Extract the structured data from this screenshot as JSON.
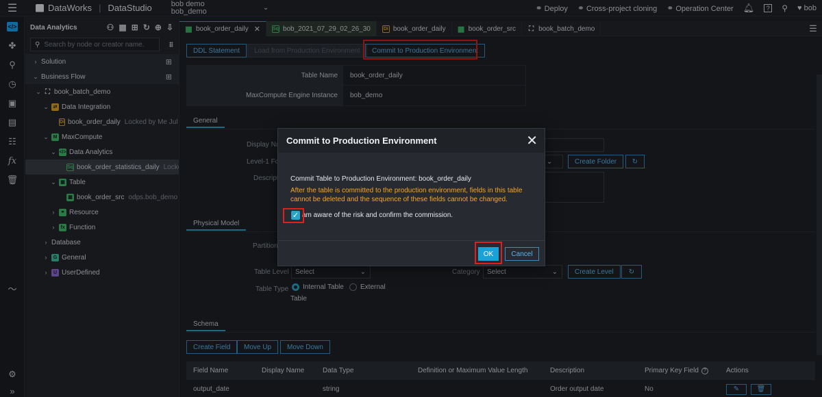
{
  "topbar": {
    "brand": "DataWorks",
    "module": "DataStudio",
    "workspace_line1": "bob demo",
    "workspace_line2": "bob_demo",
    "actions": [
      "Deploy",
      "Cross-project cloning",
      "Operation Center"
    ],
    "user": "bob"
  },
  "tree": {
    "title": "Data Analytics",
    "search_placeholder": "Search by node or creator name.",
    "items": [
      {
        "label": "Solution",
        "meta": ""
      },
      {
        "label": "Business Flow",
        "meta": ""
      },
      {
        "label": "book_batch_demo",
        "meta": ""
      },
      {
        "label": "Data Integration",
        "meta": ""
      },
      {
        "label": "book_order_daily",
        "meta": "Locked by Me  Jul 29"
      },
      {
        "label": "MaxCompute",
        "meta": ""
      },
      {
        "label": "Data Analytics",
        "meta": ""
      },
      {
        "label": "book_order_statistics_daily",
        "meta": "Locked"
      },
      {
        "label": "Table",
        "meta": ""
      },
      {
        "label": "book_order_src",
        "meta": "odps.bob_demo"
      },
      {
        "label": "Resource",
        "meta": ""
      },
      {
        "label": "Function",
        "meta": ""
      },
      {
        "label": "Database",
        "meta": ""
      },
      {
        "label": "General",
        "meta": ""
      },
      {
        "label": "UserDefined",
        "meta": ""
      }
    ]
  },
  "tabs": [
    {
      "label": "book_order_daily",
      "icon": "table-icon"
    },
    {
      "label": "bob_2021_07_29_02_26_30",
      "icon": "sql-icon"
    },
    {
      "label": "book_order_daily",
      "icon": "di-icon"
    },
    {
      "label": "book_order_src",
      "icon": "table-icon"
    },
    {
      "label": "book_batch_demo",
      "icon": "flow-icon"
    }
  ],
  "toolbar": {
    "ddl": "DDL Statement",
    "load": "Load from Production Environment",
    "commit": "Commit to Production Environment"
  },
  "props": {
    "table_name_label": "Table Name",
    "table_name": "book_order_daily",
    "engine_label": "MaxCompute Engine Instance",
    "engine": "bob_demo"
  },
  "general": {
    "tab": "General",
    "display_name_label": "Display Na",
    "folder_label": "Level-1 Fol",
    "desc_label": "Descript",
    "create_folder": "Create Folder"
  },
  "physical": {
    "tab": "Physical Model",
    "partition_label": "Partition",
    "table_level_label": "Table Level",
    "table_level_value": "Select",
    "category_label": "Category",
    "category_value": "Select",
    "create_level": "Create Level",
    "table_type_label": "Table Type",
    "internal": "Internal Table",
    "external": "External"
  },
  "schema": {
    "tab": "Schema",
    "create_field": "Create Field",
    "move_up": "Move Up",
    "move_down": "Move Down",
    "columns": [
      "Field Name",
      "Display Name",
      "Data Type",
      "Definition or Maximum Value Length",
      "Description",
      "Primary Key Field",
      "Actions"
    ],
    "row": {
      "field": "output_date",
      "display": "",
      "type": "string",
      "length": "",
      "desc": "Order output date",
      "pk": "No"
    }
  },
  "dialog": {
    "title": "Commit to Production Environment",
    "line1": "Commit Table to Production Environment: book_order_daily",
    "warning": "After the table is committed to the production environment, fields in this table cannot be deleted and the sequence of these fields cannot be changed.",
    "check_label": "am aware of the risk and confirm the commission.",
    "checked": true,
    "ok": "OK",
    "cancel": "Cancel"
  },
  "colors": {
    "accent": "#2aa5c9",
    "warning": "#f5a623",
    "highlight": "#e0201c"
  }
}
